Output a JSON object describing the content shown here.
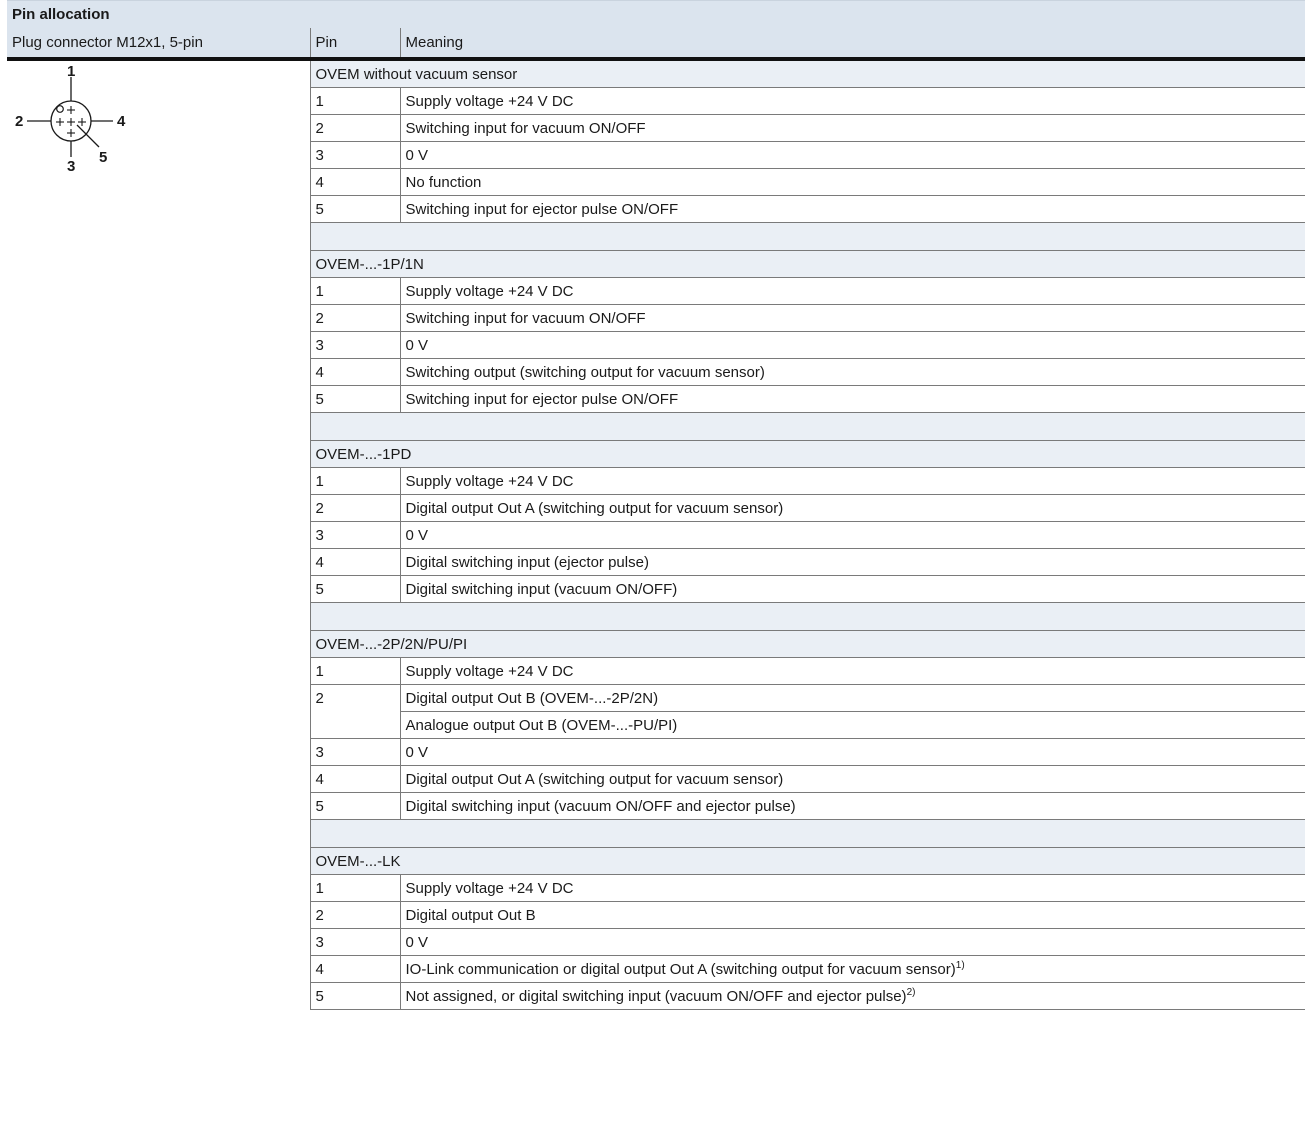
{
  "title": "Pin allocation",
  "headers": {
    "connector": "Plug connector M12x1, 5-pin",
    "pin": "Pin",
    "meaning": "Meaning"
  },
  "diagram_labels": {
    "p1": "1",
    "p2": "2",
    "p3": "3",
    "p4": "4",
    "p5": "5"
  },
  "groups": [
    {
      "name": "OVEM without vacuum sensor",
      "rows": [
        {
          "pin": "1",
          "meaning": "Supply voltage +24 V DC"
        },
        {
          "pin": "2",
          "meaning": "Switching input for vacuum ON/OFF"
        },
        {
          "pin": "3",
          "meaning": "0 V"
        },
        {
          "pin": "4",
          "meaning": "No function"
        },
        {
          "pin": "5",
          "meaning": "Switching input for ejector pulse ON/OFF"
        }
      ]
    },
    {
      "name": "OVEM-...-1P/1N",
      "rows": [
        {
          "pin": "1",
          "meaning": "Supply voltage +24 V DC"
        },
        {
          "pin": "2",
          "meaning": "Switching input for vacuum ON/OFF"
        },
        {
          "pin": "3",
          "meaning": "0 V"
        },
        {
          "pin": "4",
          "meaning": "Switching output (switching output for vacuum sensor)"
        },
        {
          "pin": "5",
          "meaning": "Switching input for ejector pulse ON/OFF"
        }
      ]
    },
    {
      "name": "OVEM-...-1PD",
      "rows": [
        {
          "pin": "1",
          "meaning": "Supply voltage +24 V DC"
        },
        {
          "pin": "2",
          "meaning": "Digital output Out A (switching output for vacuum sensor)"
        },
        {
          "pin": "3",
          "meaning": "0 V"
        },
        {
          "pin": "4",
          "meaning": "Digital switching input (ejector pulse)"
        },
        {
          "pin": "5",
          "meaning": "Digital switching input (vacuum ON/OFF)"
        }
      ]
    },
    {
      "name": "OVEM-...-2P/2N/PU/PI",
      "rows": [
        {
          "pin": "1",
          "meaning": "Supply voltage +24 V DC"
        },
        {
          "pin": "2",
          "meaning": "Digital output Out B (OVEM-...-2P/2N)"
        },
        {
          "pin": "",
          "meaning": "Analogue output Out B (OVEM-...-PU/PI)"
        },
        {
          "pin": "3",
          "meaning": "0 V"
        },
        {
          "pin": "4",
          "meaning": "Digital output Out A (switching output for vacuum sensor)"
        },
        {
          "pin": "5",
          "meaning": "Digital switching input (vacuum ON/OFF and ejector pulse)"
        }
      ]
    },
    {
      "name": "OVEM-...-LK",
      "rows": [
        {
          "pin": "1",
          "meaning": "Supply voltage +24 V DC"
        },
        {
          "pin": "2",
          "meaning": "Digital output Out B"
        },
        {
          "pin": "3",
          "meaning": "0 V"
        },
        {
          "pin": "4",
          "meaning": "IO-Link communication or digital output Out A (switching output for vacuum sensor)",
          "note": "1)"
        },
        {
          "pin": "5",
          "meaning": "Not assigned, or digital switching input (vacuum ON/OFF and ejector pulse)",
          "note": "2)"
        }
      ]
    }
  ]
}
